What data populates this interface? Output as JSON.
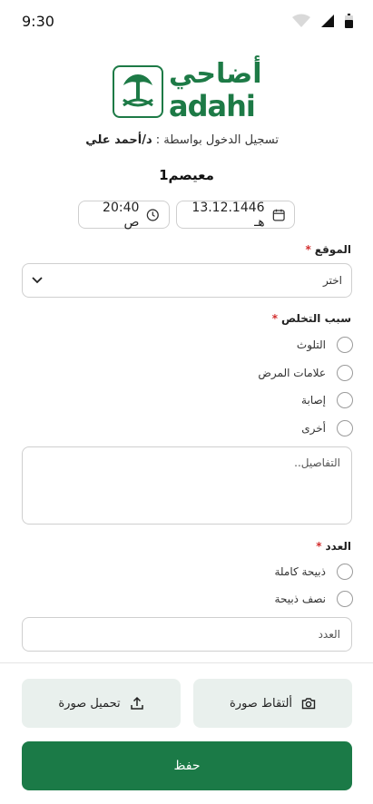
{
  "status": {
    "time": "9:30"
  },
  "logo": {
    "arabic": "أضاحي",
    "latin": "adahi"
  },
  "login": {
    "prefix": "تسجيل الدخول بواسطة :",
    "user": "د/أحمد علي"
  },
  "site_name": "معيصم1",
  "date_chip": {
    "value": "13.12.1446 هـ"
  },
  "time_chip": {
    "value": "20:40 ص"
  },
  "location": {
    "label": "الموقع",
    "required": "*",
    "placeholder": "اختر"
  },
  "disposal_reason": {
    "label": "سبب التخلص",
    "required": "*",
    "options": [
      {
        "label": "التلوث"
      },
      {
        "label": "علامات المرض"
      },
      {
        "label": "إصابة"
      },
      {
        "label": "أخرى"
      }
    ]
  },
  "details": {
    "placeholder": "التفاصيل.."
  },
  "count": {
    "label": "العدد",
    "required": "*",
    "options": [
      {
        "label": "ذبيحة كاملة"
      },
      {
        "label": "نصف ذبيحة"
      }
    ],
    "placeholder": "العدد"
  },
  "actions": {
    "upload": "تحميل صورة",
    "capture": "ألتقاط صورة",
    "save": "حفظ"
  },
  "colors": {
    "primary": "#1b7a47",
    "light": "#e9f0ed",
    "required": "#d32f2f"
  }
}
